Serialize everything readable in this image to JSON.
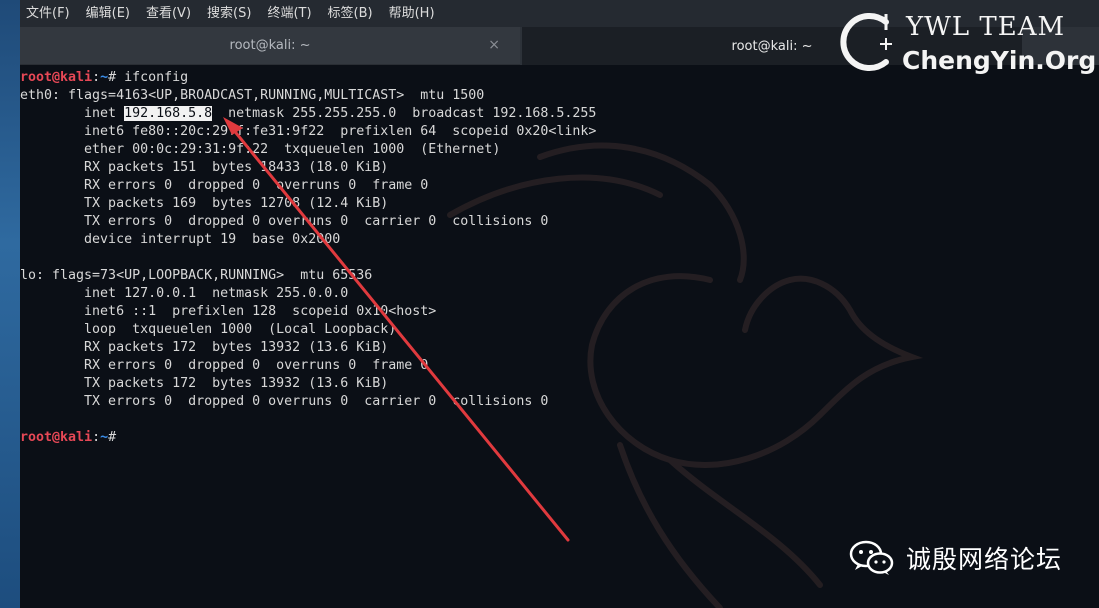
{
  "menu": [
    "文件(F)",
    "编辑(E)",
    "查看(V)",
    "搜索(S)",
    "终端(T)",
    "标签(B)",
    "帮助(H)"
  ],
  "tabs": [
    {
      "label": "root@kali: ~",
      "close": "×"
    },
    {
      "label": "root@kali: ~"
    }
  ],
  "prompt": {
    "user": "root",
    "at": "@",
    "host": "kali",
    "colon": ":",
    "path": "~",
    "symbol": "#"
  },
  "terminal": {
    "command": " ifconfig",
    "l2": "eth0: flags=4163<UP,BROADCAST,RUNNING,MULTICAST>  mtu 1500",
    "l3_pre": "        inet ",
    "l3_sel": "192.168.5.8",
    "l3_post": "  netmask 255.255.255.0  broadcast 192.168.5.255",
    "l4": "        inet6 fe80::20c:29ff:fe31:9f22  prefixlen 64  scopeid 0x20<link>",
    "l5": "        ether 00:0c:29:31:9f:22  txqueuelen 1000  (Ethernet)",
    "l6": "        RX packets 151  bytes 18433 (18.0 KiB)",
    "l7": "        RX errors 0  dropped 0  overruns 0  frame 0",
    "l8": "        TX packets 169  bytes 12708 (12.4 KiB)",
    "l9": "        TX errors 0  dropped 0 overruns 0  carrier 0  collisions 0",
    "l10": "        device interrupt 19  base 0x2000",
    "l11": "",
    "l12": "lo: flags=73<UP,LOOPBACK,RUNNING>  mtu 65536",
    "l13": "        inet 127.0.0.1  netmask 255.0.0.0",
    "l14": "        inet6 ::1  prefixlen 128  scopeid 0x10<host>",
    "l15": "        loop  txqueuelen 1000  (Local Loopback)",
    "l16": "        RX packets 172  bytes 13932 (13.6 KiB)",
    "l17": "        RX errors 0  dropped 0  overruns 0  frame 0",
    "l18": "        TX packets 172  bytes 13932 (13.6 KiB)",
    "l19": "        TX errors 0  dropped 0 overruns 0  carrier 0  collisions 0",
    "l20": ""
  },
  "watermark": {
    "title": "YWL TEAM",
    "subtitle": "ChengYin.Org",
    "logo": "C",
    "plus": "+"
  },
  "forum": {
    "label": "诚殷网络论坛",
    "icon": "wechat-icon"
  },
  "colors": {
    "prompt_user": "#e74856",
    "prompt_path": "#3b8eea",
    "arrow": "#e03a3e",
    "terminal_bg": "#0b0f16"
  }
}
